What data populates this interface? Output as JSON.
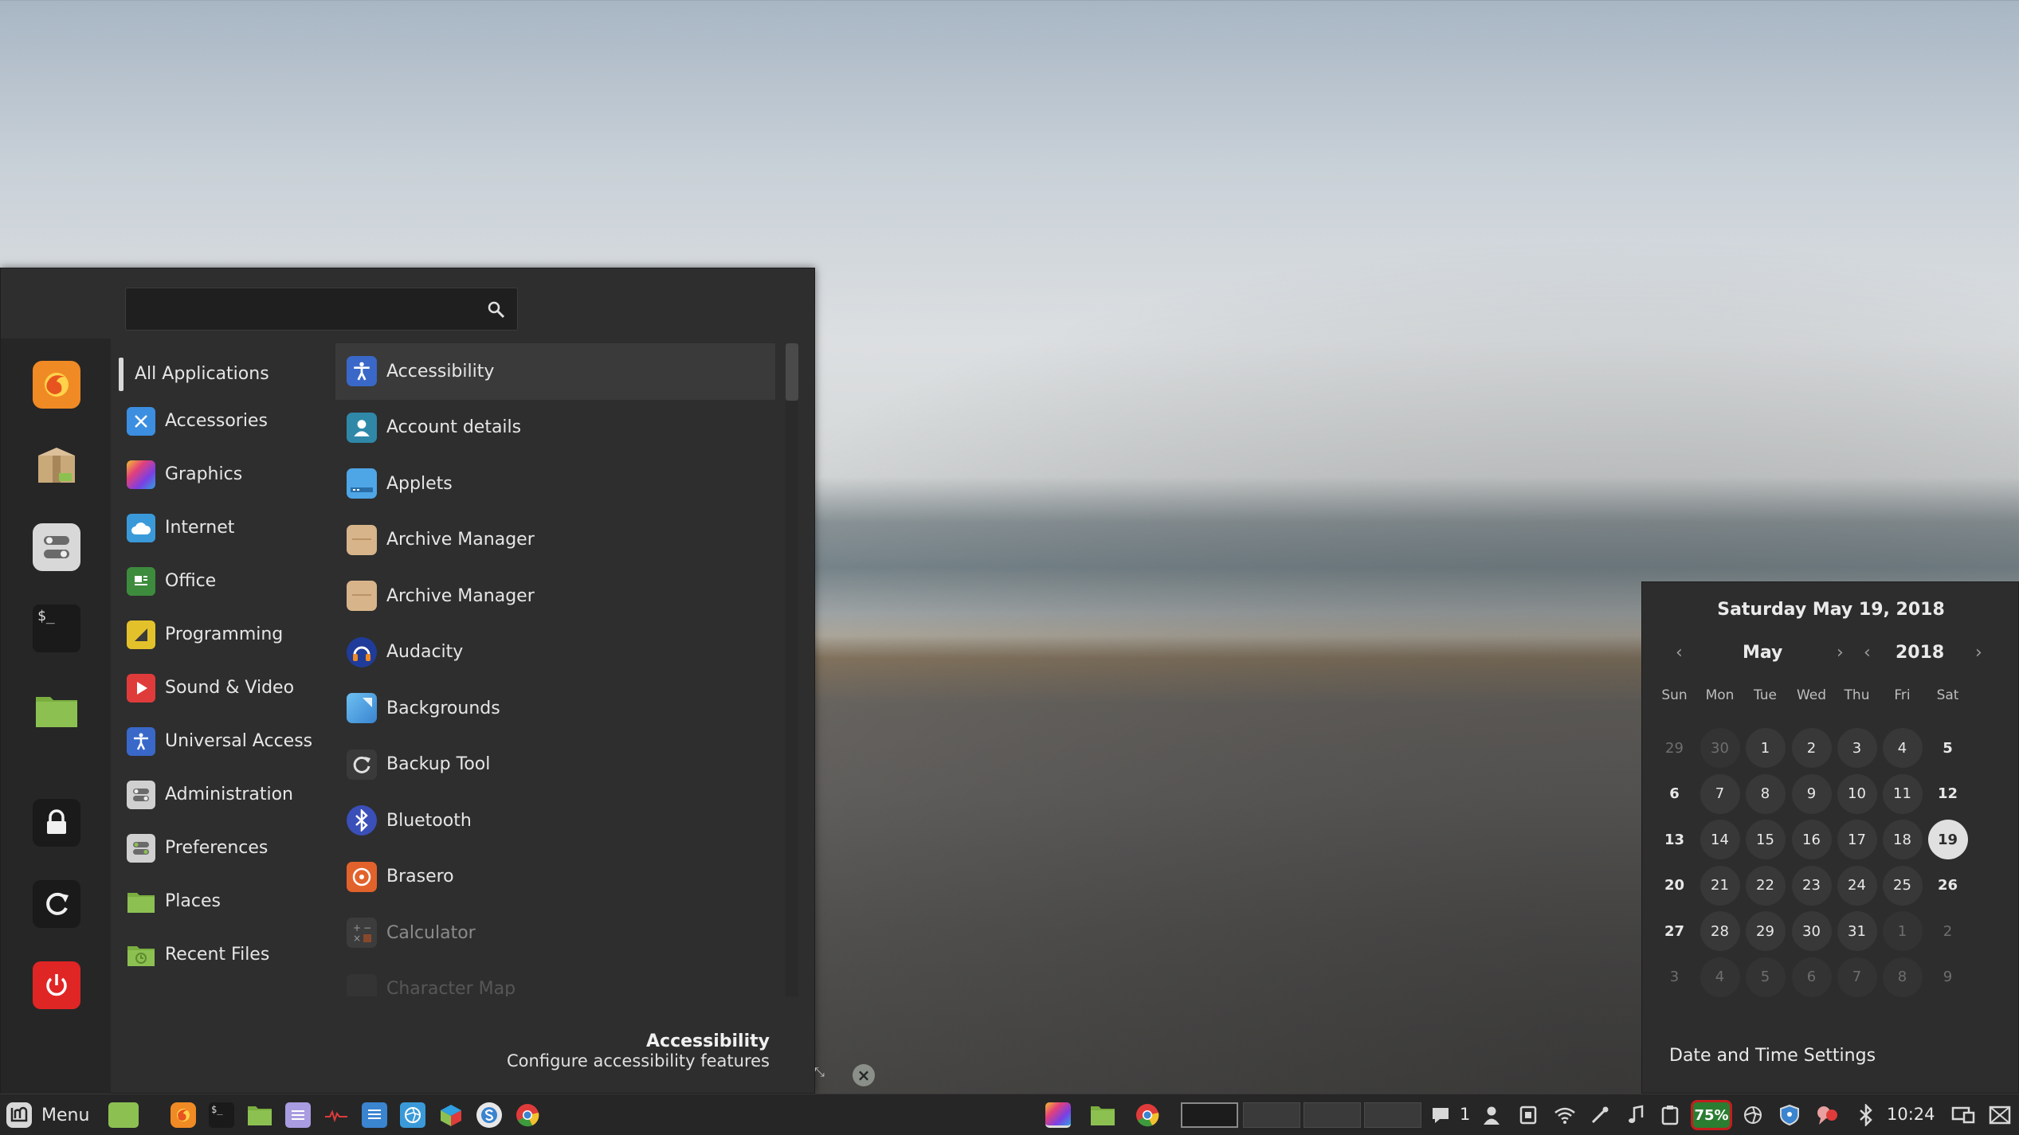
{
  "menu": {
    "search": {
      "value": "",
      "placeholder": ""
    },
    "categories": [
      {
        "label": "All Applications",
        "icon": "all-apps"
      },
      {
        "label": "Accessories",
        "icon": "accessories-icon",
        "color": "#3c8ee0"
      },
      {
        "label": "Graphics",
        "icon": "graphics-icon",
        "color": "#e3407a"
      },
      {
        "label": "Internet",
        "icon": "internet-icon",
        "color": "#3a9ad9"
      },
      {
        "label": "Office",
        "icon": "office-icon",
        "color": "#3d8b3d"
      },
      {
        "label": "Programming",
        "icon": "programming-icon",
        "color": "#e3c12b"
      },
      {
        "label": "Sound & Video",
        "icon": "sound-video-icon",
        "color": "#e03b3b"
      },
      {
        "label": "Universal Access",
        "icon": "universal-access-icon",
        "color": "#3968c8"
      },
      {
        "label": "Administration",
        "icon": "administration-icon",
        "color": "#d0d0d0"
      },
      {
        "label": "Preferences",
        "icon": "preferences-icon",
        "color": "#d0d0d0"
      },
      {
        "label": "Places",
        "icon": "places-icon",
        "color": "#8cc152"
      },
      {
        "label": "Recent Files",
        "icon": "recent-files-icon",
        "color": "#8cc152"
      }
    ],
    "apps": [
      {
        "label": "Accessibility",
        "icon": "accessibility-icon",
        "color": "#3968c8"
      },
      {
        "label": "Account details",
        "icon": "account-details-icon",
        "color": "#2f88a8"
      },
      {
        "label": "Applets",
        "icon": "applets-icon",
        "color": "#4ea6e6"
      },
      {
        "label": "Archive Manager",
        "icon": "archive-manager-icon",
        "color": "#d8b48a"
      },
      {
        "label": "Archive Manager",
        "icon": "archive-manager-icon",
        "color": "#d8b48a"
      },
      {
        "label": "Audacity",
        "icon": "audacity-icon",
        "color": "#1f3c9a"
      },
      {
        "label": "Backgrounds",
        "icon": "backgrounds-icon",
        "color": "#4ea6e6"
      },
      {
        "label": "Backup Tool",
        "icon": "backup-tool-icon",
        "color": "#555555"
      },
      {
        "label": "Bluetooth",
        "icon": "bluetooth-icon",
        "color": "#3a4fb8"
      },
      {
        "label": "Brasero",
        "icon": "brasero-icon",
        "color": "#e2622b"
      },
      {
        "label": "Calculator",
        "icon": "calculator-icon",
        "color": "#4a4a4a"
      },
      {
        "label": "Character Map",
        "icon": "character-map-icon",
        "color": "#4a4a4a"
      }
    ],
    "description": {
      "title": "Accessibility",
      "text": "Configure accessibility features"
    },
    "favorites": [
      {
        "name": "firefox-icon",
        "color": "#f08a24"
      },
      {
        "name": "software-manager-icon",
        "color": "#c9a97a"
      },
      {
        "name": "settings-toggle-icon",
        "color": "#d8d8d8"
      },
      {
        "name": "terminal-icon",
        "color": "#1a1a1a"
      },
      {
        "name": "files-folder-icon",
        "color": "#8cc152"
      },
      {
        "name": "lock-screen-icon",
        "color": "#1a1a1a"
      },
      {
        "name": "logout-icon",
        "color": "#1a1a1a"
      },
      {
        "name": "shutdown-icon",
        "color": "#e02525"
      }
    ]
  },
  "calendar": {
    "title": "Saturday May 19, 2018",
    "month": "May",
    "year": "2018",
    "weekdays": [
      "Sun",
      "Mon",
      "Tue",
      "Wed",
      "Thu",
      "Fri",
      "Sat"
    ],
    "weeks": [
      [
        "29",
        "30",
        "1",
        "2",
        "3",
        "4",
        "5"
      ],
      [
        "6",
        "7",
        "8",
        "9",
        "10",
        "11",
        "12"
      ],
      [
        "13",
        "14",
        "15",
        "16",
        "17",
        "18",
        "19"
      ],
      [
        "20",
        "21",
        "22",
        "23",
        "24",
        "25",
        "26"
      ],
      [
        "27",
        "28",
        "29",
        "30",
        "31",
        "1",
        "2"
      ],
      [
        "3",
        "4",
        "5",
        "6",
        "7",
        "8",
        "9"
      ]
    ],
    "today": "19",
    "settings_label": "Date and Time Settings"
  },
  "panel": {
    "menu_label": "Menu",
    "notifications_count": "1",
    "battery": "75%",
    "clock": "10:24"
  }
}
